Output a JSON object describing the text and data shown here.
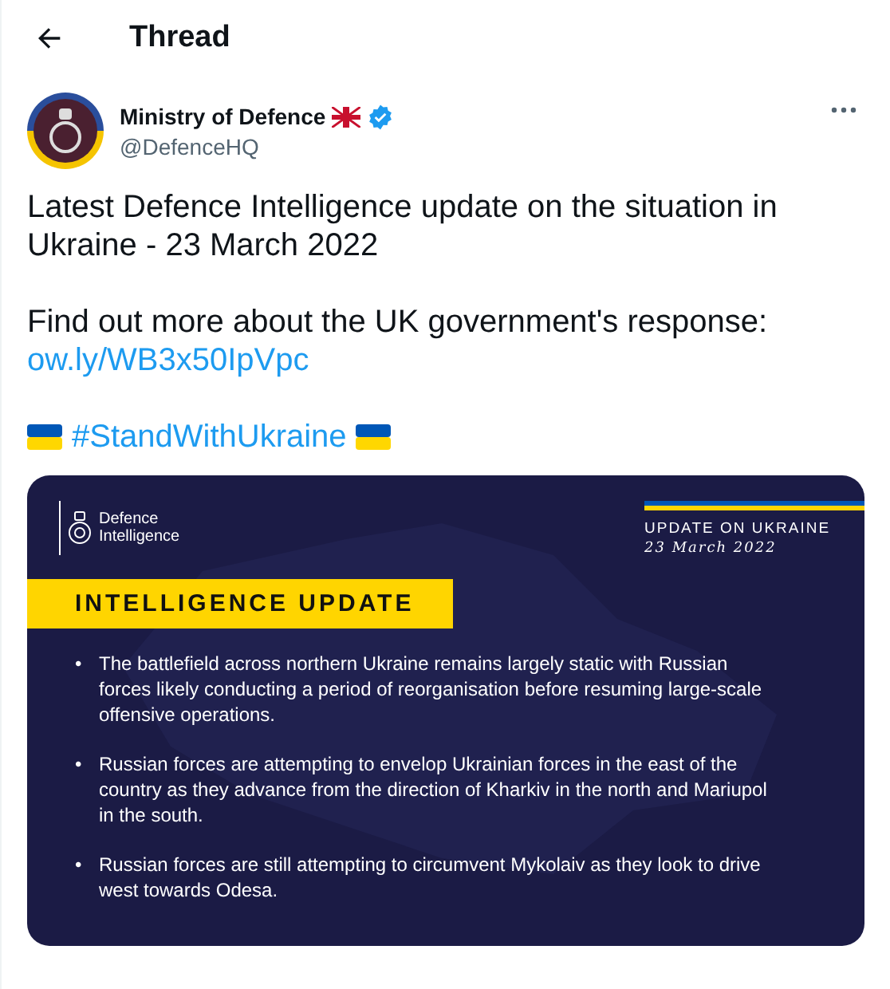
{
  "header": {
    "title": "Thread"
  },
  "tweet": {
    "author": {
      "name": "Ministry of Defence",
      "handle": "@DefenceHQ",
      "verified": true
    },
    "text": "Latest Defence Intelligence update on the situation in Ukraine - 23 March 2022",
    "lead": "Find out more about the UK government's response:",
    "link": "ow.ly/WB3x50IpVpc",
    "hashtag": "#StandWithUkraine",
    "infographic": {
      "logo_lines": [
        "Defence",
        "Intelligence"
      ],
      "label": "UPDATE ON UKRAINE",
      "date": "23 March 2022",
      "banner": "INTELLIGENCE UPDATE",
      "bullets": [
        {
          "marker": "•",
          "text": "The battlefield across northern Ukraine remains largely static with Russian forces likely conducting a period of reorganisation before resuming large-scale offensive operations."
        },
        {
          "marker": "•",
          "text": "Russian forces are attempting to envelop Ukrainian forces in the east of the country as they advance from the direction of Kharkiv in the north and Mariupol in the south."
        },
        {
          "marker": "•",
          "text": "Russian forces are still attempting to circumvent Mykolaiv as they look to drive west towards Odesa."
        }
      ]
    }
  }
}
